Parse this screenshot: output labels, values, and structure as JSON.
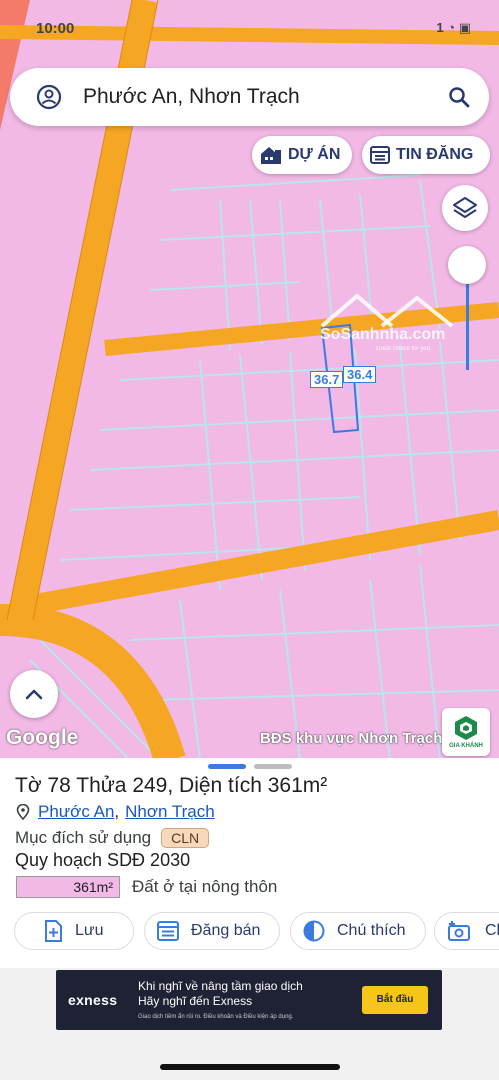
{
  "status_bar": {
    "time": "10:00",
    "right_text": "1 ◔ ▣"
  },
  "search": {
    "query": "Phước An, Nhơn Trạch"
  },
  "chips": {
    "du_an": "DỰ ÁN",
    "tin_dang": "TIN ĐĂNG"
  },
  "map": {
    "watermark_brand": "SoSanhnha.com",
    "watermark_tagline": "Great choice for you",
    "dim_left": "36.7",
    "dim_right": "36.4",
    "google_logo": "Google",
    "caption": "BĐS khu vực Nhơn Trạch",
    "agency_name": "GIA KHÁNH"
  },
  "parcel": {
    "title": "Tờ 78 Thửa 249, Diện tích 361m²",
    "ward": "Phước An",
    "comma": ",",
    "district": "Nhơn Trạch",
    "purpose_label": "Mục đích sử dụng",
    "purpose_code": "CLN",
    "plan_label": "Quy hoạch SDĐ 2030",
    "legend_area": "361m²",
    "legend_desc": "Đất ở tại nông thôn"
  },
  "actions": {
    "save": "Lưu",
    "sell": "Đăng bán",
    "note": "Chú thích",
    "photo": "Ch"
  },
  "ad": {
    "brand": "exness",
    "line1": "Khi nghĩ về nâng tầm giao dịch",
    "line2": "Hãy nghĩ đến Exness",
    "fine_print": "Giao dịch tiềm ẩn rủi ro. Điều khoản và Điều kiện áp dụng.",
    "cta": "Bắt đầu"
  },
  "colors": {
    "land_fill": "#f2b8e6",
    "road": "#f5a623",
    "parcel_line": "#b8e6ec",
    "accent": "#3b7be0"
  }
}
